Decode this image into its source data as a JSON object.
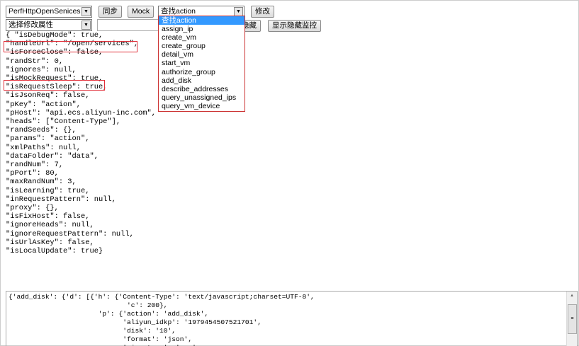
{
  "toolbar": {
    "service_select": "PerfHttpOpenSenices",
    "sync": "同步",
    "mock": "Mock",
    "action_select": "查找action",
    "modify": "修改",
    "attr_select": "选择修改属性",
    "attr_value": "",
    "hide": "隐藏",
    "show_hidden": "显示隐藏监控"
  },
  "dropdown": {
    "options": [
      "查找action",
      "assign_ip",
      "create_vm",
      "create_group",
      "detail_vm",
      "start_vm",
      "authorize_group",
      "add_disk",
      "describe_addresses",
      "query_unassigned_ips",
      "query_vm_device"
    ]
  },
  "config_lines": [
    "{ \"isDebugMode\": true,",
    "\"handleUrl\": \"/open/services\",",
    "\"isForceClose\": false,",
    "\"randStr\": 0,",
    "\"ignores\": null,",
    "\"isMockRequest\": true,",
    "\"isRequestSleep\": true,",
    "\"isJsonReq\": false,",
    "\"pKey\": \"action\",",
    "\"pHost\": \"api.ecs.aliyun-inc.com\",",
    "\"heads\": [\"Content-Type\"],",
    "\"randSeeds\": {},",
    "\"params\": \"action\",",
    "\"xmlPaths\": null,",
    "\"dataFolder\": \"data\",",
    "\"randNum\": 7,",
    "\"pPort\": 80,",
    "\"maxRandNum\": 3,",
    "\"isLearning\": true,",
    "\"inRequestPattern\": null,",
    "\"proxy\": {},",
    "\"isFixHost\": false,",
    "\"ignoreHeads\": null,",
    "\"ignoreRequestPattern\": null,",
    "\"isUrlAsKey\": false,",
    "\"isLocalUpdate\": true}"
  ],
  "output_lines": [
    "{'add_disk': {'d': [{'h': {'Content-Type': 'text/javascript;charset=UTF-8',",
    "                             'c': 200},",
    "                      'p': {'action': 'add_disk',",
    "                            'aliyun_idkp': '1979454507521701',",
    "                            'disk': '10',",
    "                            'format': 'json',",
    "                            'signature': '...'"
  ]
}
